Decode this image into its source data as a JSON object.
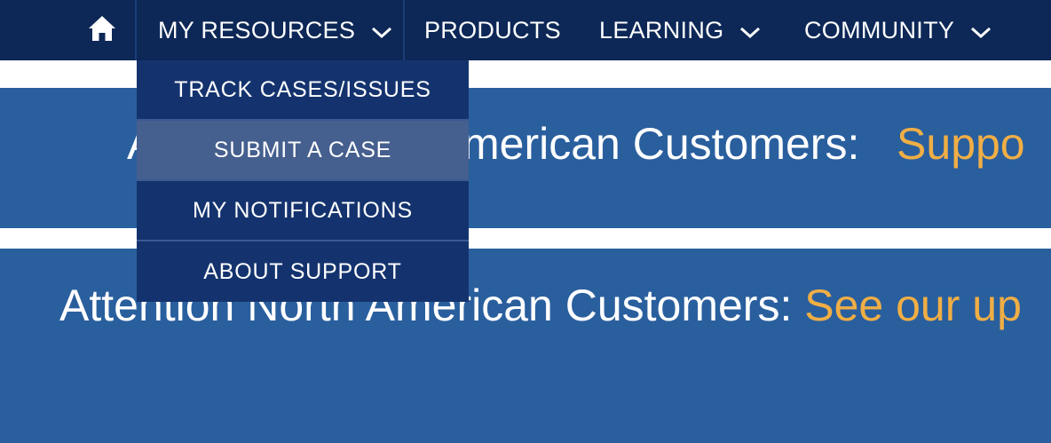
{
  "nav": {
    "home_icon": "home-icon",
    "my_resources": "MY RESOURCES",
    "products": "PRODUCTS",
    "learning": "LEARNING",
    "community": "COMMUNITY"
  },
  "dropdown": {
    "items": [
      {
        "label": "TRACK CASES/ISSUES"
      },
      {
        "label": "SUBMIT A CASE"
      },
      {
        "label": "MY NOTIFICATIONS"
      },
      {
        "label": "ABOUT SUPPORT"
      }
    ]
  },
  "banners": [
    {
      "text": "Attention North American Customers:",
      "link": "Suppo"
    },
    {
      "text": "Attention North American Customers:",
      "link": "See our up"
    }
  ],
  "colors": {
    "nav_bg": "#0d2857",
    "dropdown_bg": "#14336e",
    "dropdown_hover": "#455f8e",
    "banner_bg": "#2a5f9e",
    "link": "#f0ae45"
  }
}
